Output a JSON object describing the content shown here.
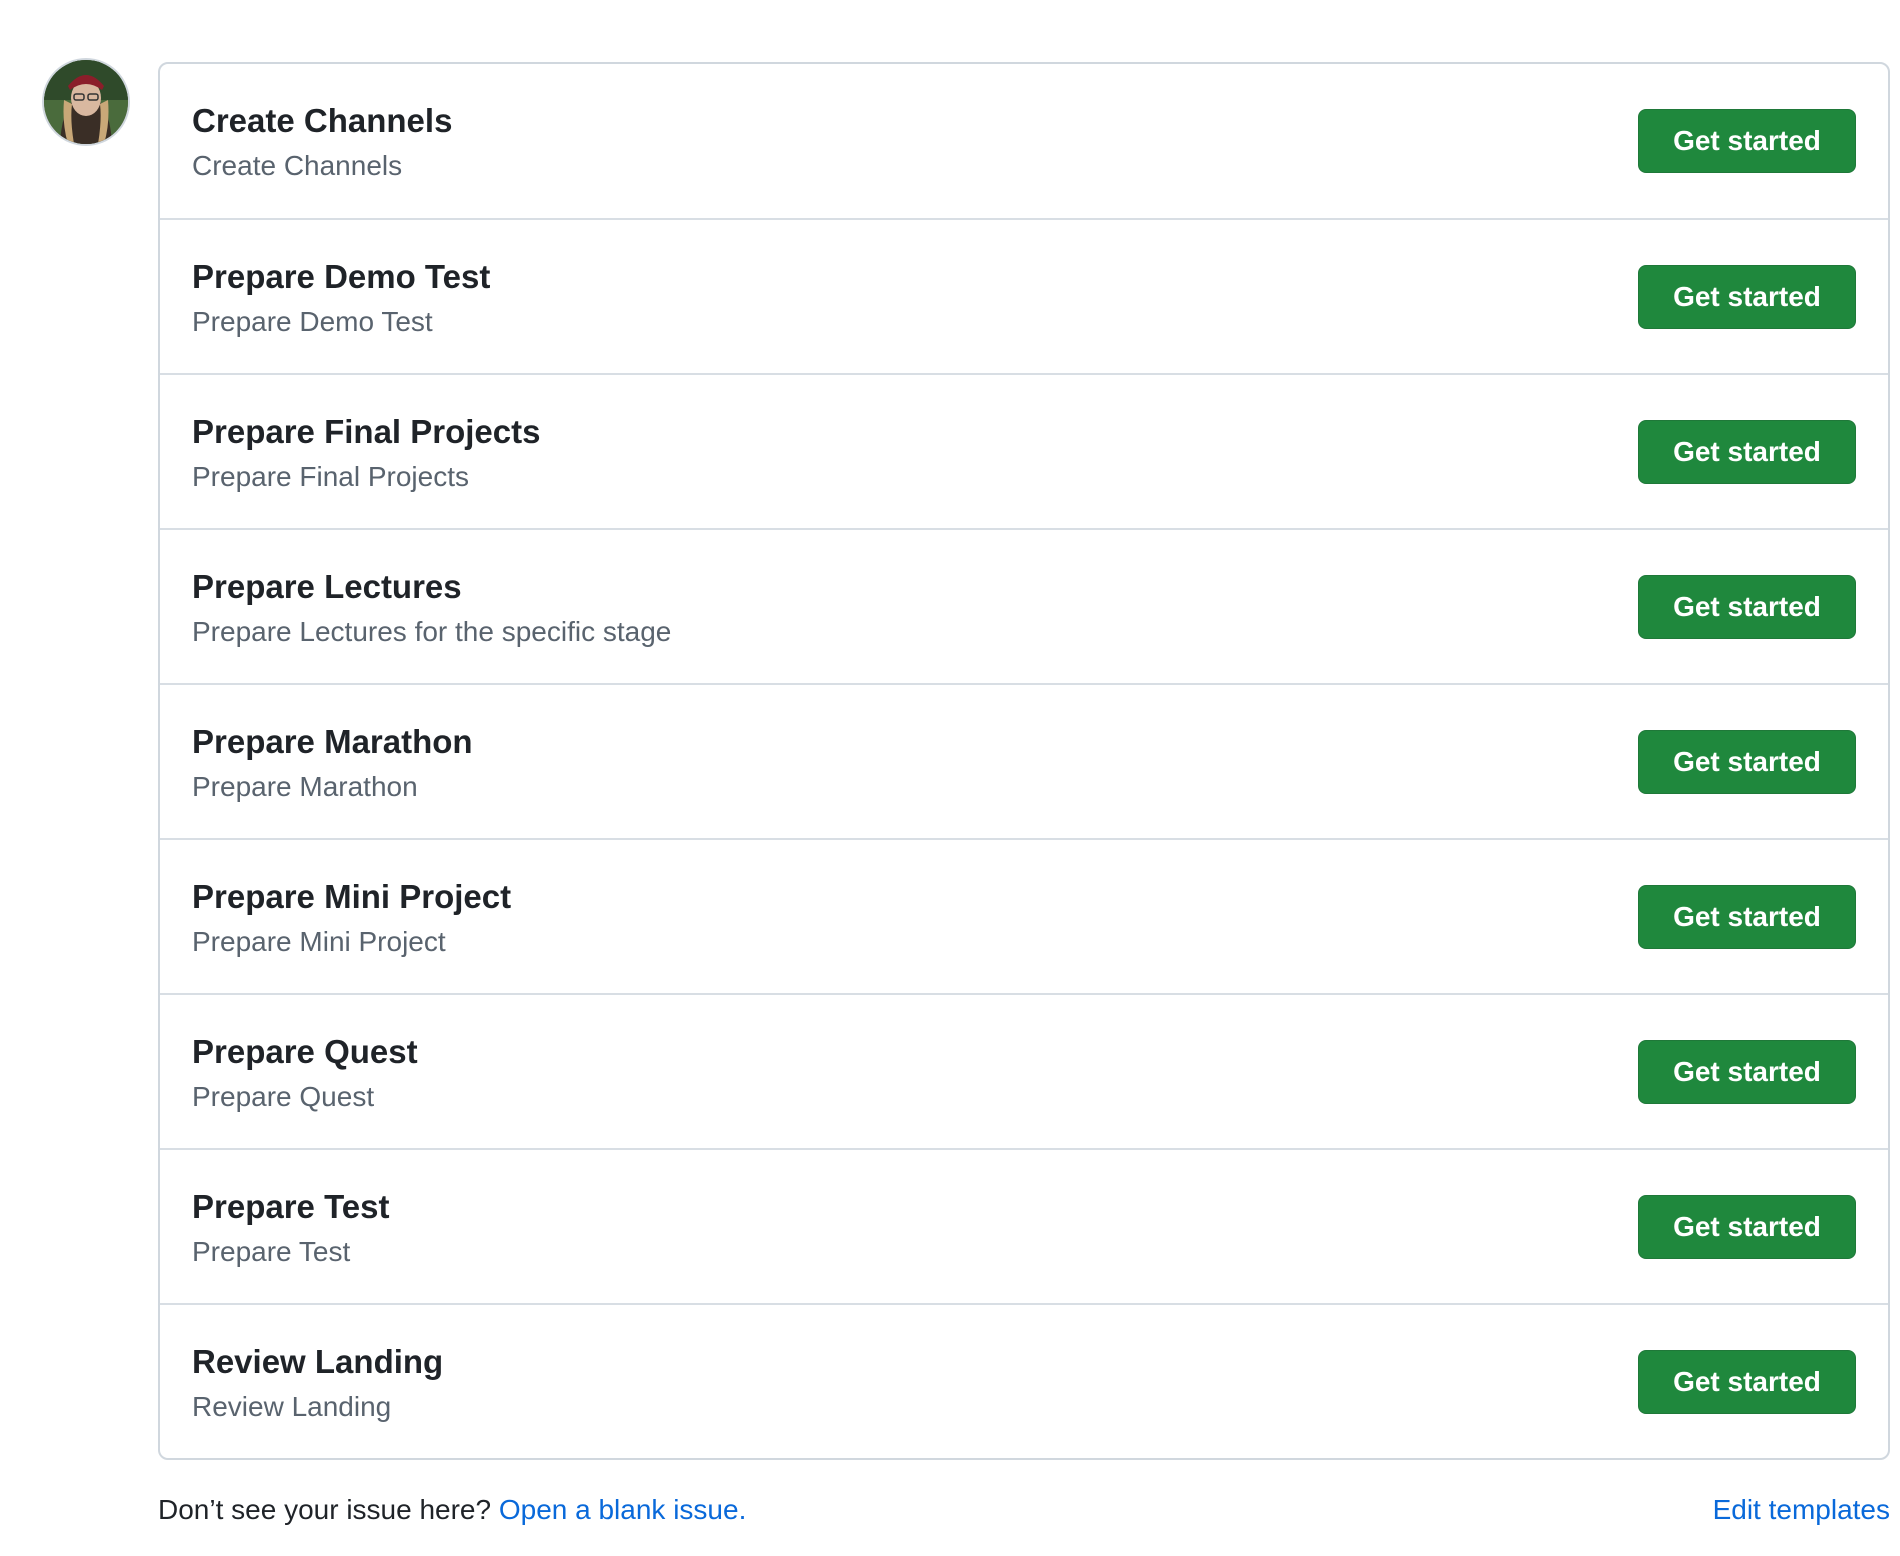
{
  "templates": [
    {
      "title": "Create Channels",
      "description": "Create Channels",
      "button": "Get started"
    },
    {
      "title": "Prepare Demo Test",
      "description": "Prepare Demo Test",
      "button": "Get started"
    },
    {
      "title": "Prepare Final Projects",
      "description": "Prepare Final Projects",
      "button": "Get started"
    },
    {
      "title": "Prepare Lectures",
      "description": "Prepare Lectures for the specific stage",
      "button": "Get started"
    },
    {
      "title": "Prepare Marathon",
      "description": "Prepare Marathon",
      "button": "Get started"
    },
    {
      "title": "Prepare Mini Project",
      "description": "Prepare Mini Project",
      "button": "Get started"
    },
    {
      "title": "Prepare Quest",
      "description": "Prepare Quest",
      "button": "Get started"
    },
    {
      "title": "Prepare Test",
      "description": "Prepare Test",
      "button": "Get started"
    },
    {
      "title": "Review Landing",
      "description": "Review Landing",
      "button": "Get started"
    }
  ],
  "footer": {
    "prompt": "Don’t see your issue here?",
    "blank_issue_link": "Open a blank issue.",
    "edit_templates_link": "Edit templates"
  },
  "colors": {
    "button_green": "#1f883d",
    "link_blue": "#0969da",
    "border": "#d0d7de",
    "muted_text": "#59636e"
  }
}
